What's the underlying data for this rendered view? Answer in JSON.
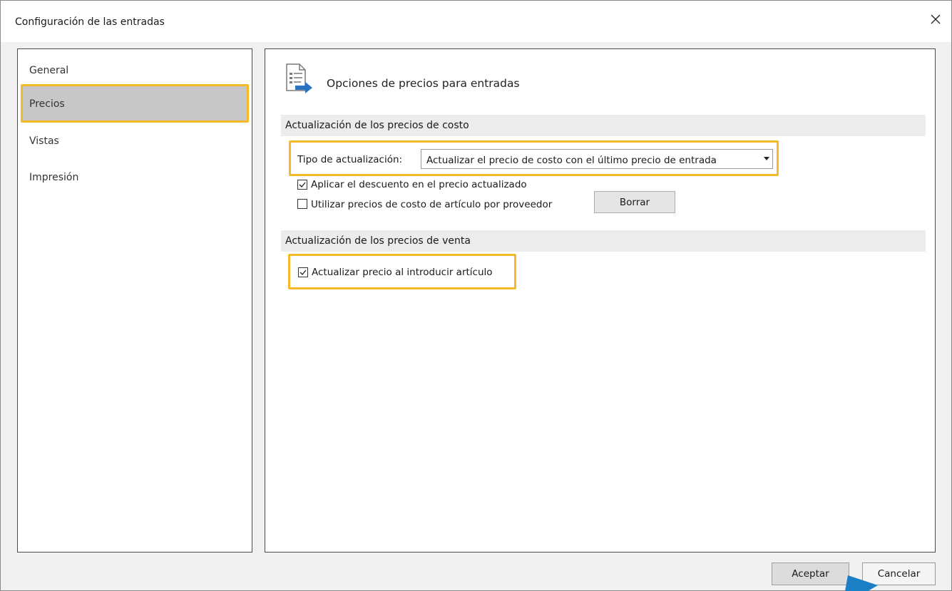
{
  "window": {
    "title": "Configuración de las entradas"
  },
  "sidebar": {
    "items": [
      {
        "label": "General"
      },
      {
        "label": "Precios",
        "selected": true
      },
      {
        "label": "Vistas"
      },
      {
        "label": "Impresión"
      }
    ]
  },
  "main": {
    "page_title": "Opciones de precios para entradas",
    "cost_section": {
      "header": "Actualización de los precios de costo",
      "update_type_label": "Tipo de actualización:",
      "update_type_value": "Actualizar el precio de costo con el último precio de entrada",
      "apply_discount": {
        "label": "Aplicar el descuento en el precio actualizado",
        "checked": true
      },
      "supplier_prices": {
        "label": "Utilizar precios de costo de artículo por proveedor",
        "checked": false
      },
      "clear_button": "Borrar"
    },
    "sale_section": {
      "header": "Actualización de los precios de venta",
      "update_on_item": {
        "label": "Actualizar precio al introducir artículo",
        "checked": true
      }
    }
  },
  "footer": {
    "accept": "Aceptar",
    "cancel": "Cancelar"
  },
  "colors": {
    "highlight": "#f6b928",
    "selected_bg": "#c7c7c7",
    "cursor": "#1a7fc4",
    "icon_arrow": "#2b73c2"
  },
  "icons": {
    "close": "close-icon",
    "page": "document-arrow-icon",
    "cursor": "mouse-pointer-icon"
  }
}
